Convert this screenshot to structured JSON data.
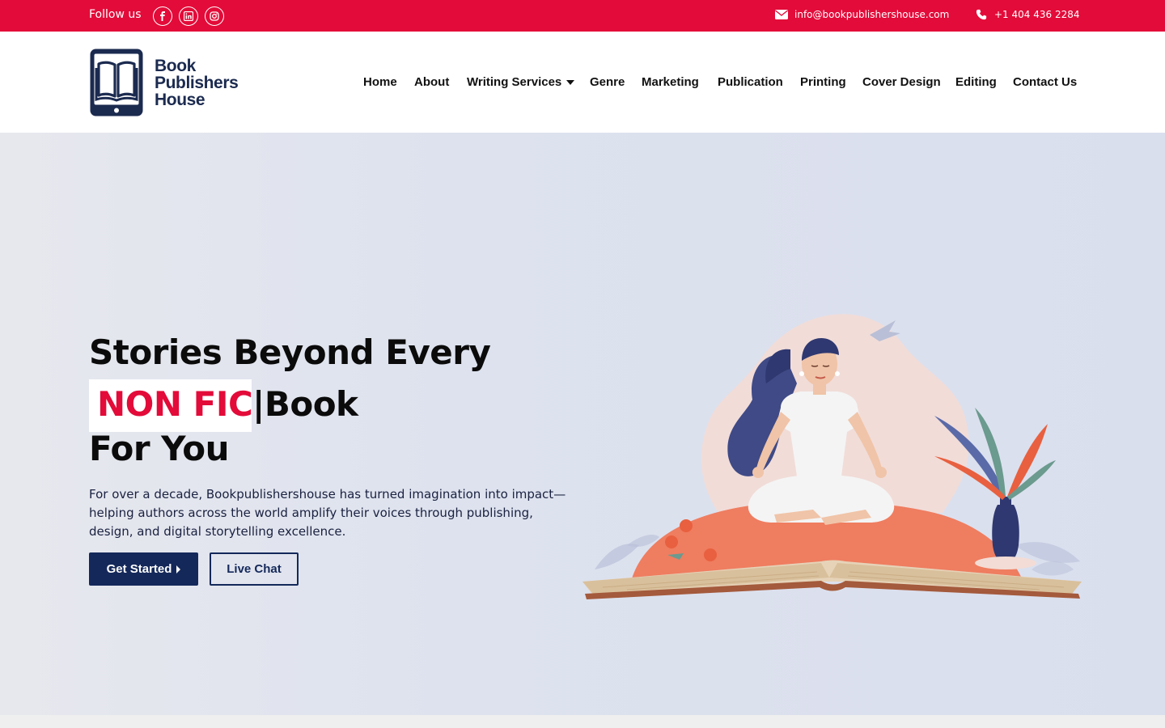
{
  "topbar": {
    "follow_label": "Follow us",
    "social": [
      {
        "icon": "facebook-icon"
      },
      {
        "icon": "linkedin-icon"
      },
      {
        "icon": "instagram-icon"
      }
    ],
    "email": "info@bookpublishershouse.com",
    "phone": "+1 404 436 2284",
    "bg_color": "#e30b39"
  },
  "logo": {
    "line1": "Book",
    "line2": "Publishers",
    "line3": "House",
    "color": "#1b2a4f"
  },
  "nav": {
    "items": [
      {
        "label": "Home"
      },
      {
        "label": "About"
      },
      {
        "label": "Writing Services",
        "has_dropdown": true
      },
      {
        "label": "Genre"
      },
      {
        "label": "Marketing"
      },
      {
        "label": "Publication"
      },
      {
        "label": "Printing"
      },
      {
        "label": "Cover Design"
      },
      {
        "label": "Editing"
      },
      {
        "label": "Contact Us"
      }
    ]
  },
  "hero": {
    "heading_line1": "Stories Beyond Every",
    "rotating_word": "NON FIC",
    "heading_after_rotator": "|Book",
    "heading_line3": "For You",
    "description": "For over a decade, Bookpublishershouse has turned imagination into impact—helping authors across the world amplify their voices through publishing, design, and digital storytelling excellence.",
    "primary_button": "Get Started",
    "secondary_button": "Live Chat",
    "accent_color": "#e30b39",
    "button_color": "#14285a"
  }
}
